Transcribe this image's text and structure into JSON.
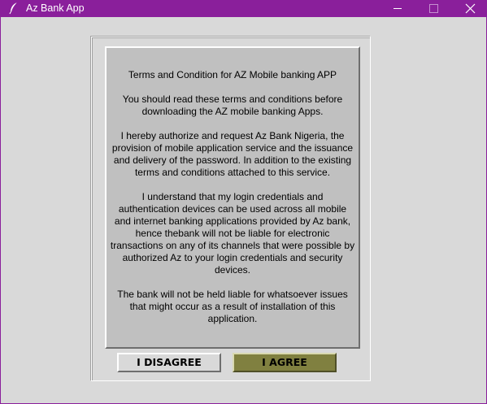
{
  "window": {
    "title": "Az Bank App",
    "title_bar_color": "#8a1f9b",
    "icon": "feather-icon",
    "controls": [
      "minimize-icon",
      "maximize-icon",
      "close-icon"
    ]
  },
  "terms": {
    "heading": "Terms and Condition for AZ Mobile banking APP",
    "paragraphs": [
      "You should read these terms and conditions before\ndownloading the AZ mobile banking Apps.",
      "I hereby authorize and request Az Bank Nigeria, the\nprovision of mobile application service and the issuance\nand delivery of the password. In addition to the existing\nterms and conditions attached to this service.",
      "I understand that my login credentials and\nauthentication devices can be used across all mobile\nand internet banking applications provided by Az bank,\nhence thebank will not be liable for electronic\ntransactions on any of its channels that were possible by\nauthorized Az to your login credentials and security\ndevices.",
      "The bank will not be held liable for whatsoever issues\nthat might occur as a result of installation of this\napplication."
    ],
    "panel_color": "#c0c0c0"
  },
  "buttons": {
    "disagree_label": "I DISAGREE",
    "agree_label": "I AGREE",
    "agree_color": "#808040"
  }
}
